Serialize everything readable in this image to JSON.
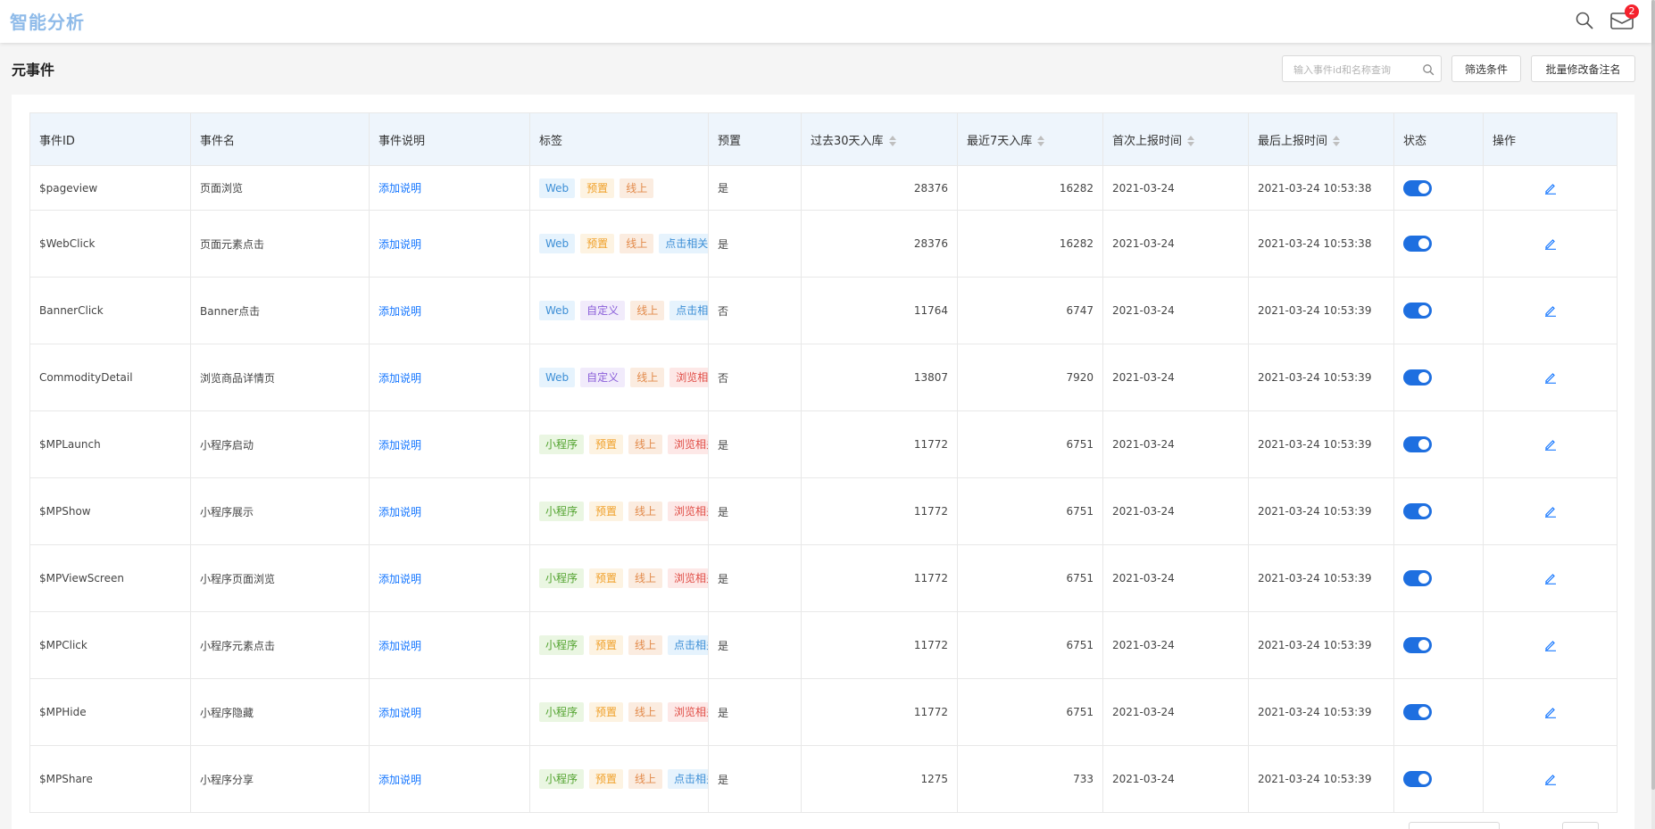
{
  "app": {
    "brand": "智能分析",
    "notification_count": "2"
  },
  "page": {
    "title": "元事件"
  },
  "toolbar": {
    "search_placeholder": "输入事件id和名称查询",
    "filter_label": "筛选条件",
    "batch_label": "批量修改备注名"
  },
  "table": {
    "headers": [
      "事件ID",
      "事件名",
      "事件说明",
      "标签",
      "预置",
      "过去30天入库",
      "最近7天入库",
      "首次上报时间",
      "最后上报时间",
      "状态",
      "操作"
    ],
    "add_desc_label": "添加说明",
    "rows": [
      {
        "id": "$pageview",
        "name": "页面浏览",
        "desc": "添加说明",
        "tags": [
          "Web",
          "预置",
          "线上"
        ],
        "preset": "是",
        "d30": "28376",
        "d7": "16282",
        "first": "2021-03-24",
        "last": "2021-03-24 10:53:38",
        "enabled": true
      },
      {
        "id": "$WebClick",
        "name": "页面元素点击",
        "desc": "添加说明",
        "tags": [
          "Web",
          "预置",
          "线上",
          "点击相关"
        ],
        "preset": "是",
        "d30": "28376",
        "d7": "16282",
        "first": "2021-03-24",
        "last": "2021-03-24 10:53:38",
        "enabled": true
      },
      {
        "id": "BannerClick",
        "name": "Banner点击",
        "desc": "添加说明",
        "tags": [
          "Web",
          "自定义",
          "线上",
          "点击相关"
        ],
        "preset": "否",
        "d30": "11764",
        "d7": "6747",
        "first": "2021-03-24",
        "last": "2021-03-24 10:53:39",
        "enabled": true
      },
      {
        "id": "CommodityDetail",
        "name": "浏览商品详情页",
        "desc": "添加说明",
        "tags": [
          "Web",
          "自定义",
          "线上",
          "浏览相关"
        ],
        "preset": "否",
        "d30": "13807",
        "d7": "7920",
        "first": "2021-03-24",
        "last": "2021-03-24 10:53:39",
        "enabled": true
      },
      {
        "id": "$MPLaunch",
        "name": "小程序启动",
        "desc": "添加说明",
        "tags": [
          "小程序",
          "预置",
          "线上",
          "浏览相关"
        ],
        "preset": "是",
        "d30": "11772",
        "d7": "6751",
        "first": "2021-03-24",
        "last": "2021-03-24 10:53:39",
        "enabled": true
      },
      {
        "id": "$MPShow",
        "name": "小程序展示",
        "desc": "添加说明",
        "tags": [
          "小程序",
          "预置",
          "线上",
          "浏览相关"
        ],
        "preset": "是",
        "d30": "11772",
        "d7": "6751",
        "first": "2021-03-24",
        "last": "2021-03-24 10:53:39",
        "enabled": true
      },
      {
        "id": "$MPViewScreen",
        "name": "小程序页面浏览",
        "desc": "添加说明",
        "tags": [
          "小程序",
          "预置",
          "线上",
          "浏览相关"
        ],
        "preset": "是",
        "d30": "11772",
        "d7": "6751",
        "first": "2021-03-24",
        "last": "2021-03-24 10:53:39",
        "enabled": true
      },
      {
        "id": "$MPClick",
        "name": "小程序元素点击",
        "desc": "添加说明",
        "tags": [
          "小程序",
          "预置",
          "线上",
          "点击相关"
        ],
        "preset": "是",
        "d30": "11772",
        "d7": "6751",
        "first": "2021-03-24",
        "last": "2021-03-24 10:53:39",
        "enabled": true
      },
      {
        "id": "$MPHide",
        "name": "小程序隐藏",
        "desc": "添加说明",
        "tags": [
          "小程序",
          "预置",
          "线上",
          "浏览相关"
        ],
        "preset": "是",
        "d30": "11772",
        "d7": "6751",
        "first": "2021-03-24",
        "last": "2021-03-24 10:53:39",
        "enabled": true
      },
      {
        "id": "$MPShare",
        "name": "小程序分享",
        "desc": "添加说明",
        "tags": [
          "小程序",
          "预置",
          "线上",
          "点击相关"
        ],
        "preset": "是",
        "d30": "1275",
        "d7": "733",
        "first": "2021-03-24",
        "last": "2021-03-24 10:53:39",
        "enabled": true
      }
    ]
  },
  "icons": {
    "top_search": "search-icon",
    "mail": "mail-icon",
    "edit": "edit-icon",
    "input_search": "search-icon"
  },
  "colors": {
    "brand": "#8fbbe9",
    "header_bg": "#eef5fc",
    "link": "#1677ff",
    "toggle_on": "#1e6fe0",
    "badge": "#f5222d"
  }
}
